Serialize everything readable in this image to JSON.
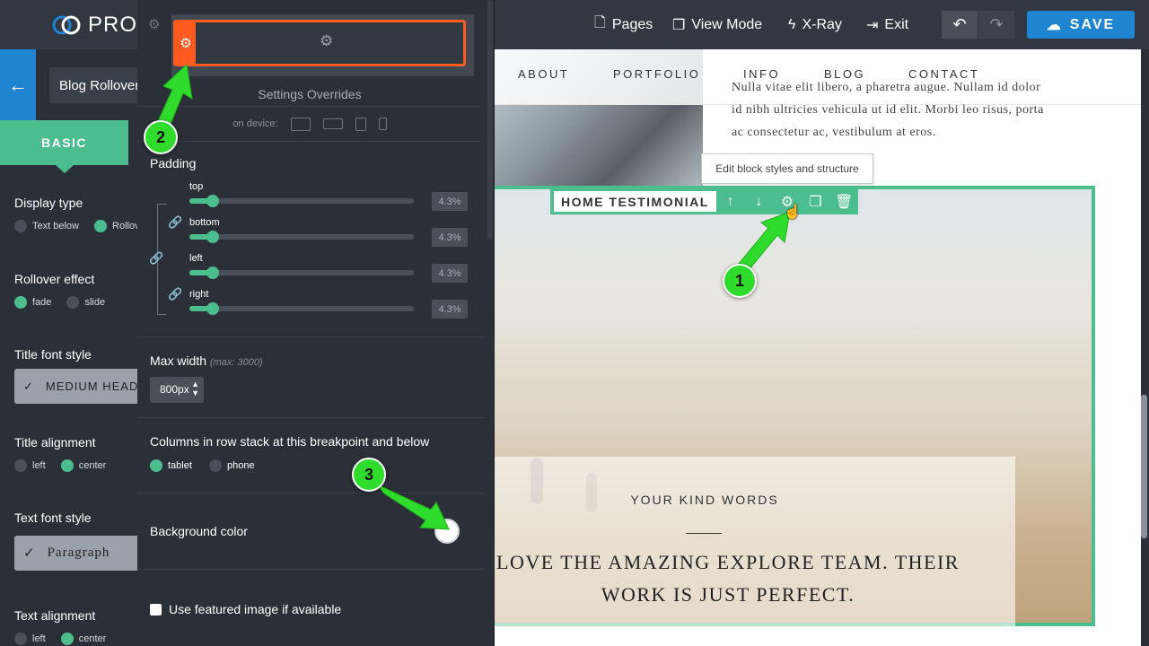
{
  "topbar": {
    "logo_text": "PRO",
    "nav": [
      {
        "label": "Pages"
      },
      {
        "label": "View Mode"
      },
      {
        "label": "X-Ray"
      },
      {
        "label": "Exit"
      }
    ],
    "save_label": "SAVE"
  },
  "left_panel": {
    "block_name": "Blog Rollover",
    "tab_label": "BASIC",
    "display_type": {
      "label": "Display type",
      "options": [
        "Text below",
        "Rollover"
      ],
      "selected": "Rollover"
    },
    "rollover_effect": {
      "label": "Rollover effect",
      "options": [
        "fade",
        "slide"
      ],
      "selected": "fade"
    },
    "title_font_style": {
      "label": "Title font style",
      "value": "MEDIUM HEADING"
    },
    "title_alignment": {
      "label": "Title alignment",
      "options": [
        "left",
        "center"
      ],
      "selected": "center"
    },
    "text_font_style": {
      "label": "Text font style",
      "value": "Paragraph"
    },
    "text_alignment": {
      "label": "Text alignment",
      "options": [
        "left",
        "center"
      ],
      "selected": "center"
    }
  },
  "settings": {
    "title": "Settings Overrides",
    "device_label": "on device:",
    "padding": {
      "label": "Padding",
      "rows": [
        {
          "name": "top",
          "value": "4.3%",
          "fraction": 0.043
        },
        {
          "name": "bottom",
          "value": "4.3%",
          "fraction": 0.043
        },
        {
          "name": "left",
          "value": "4.3%",
          "fraction": 0.043
        },
        {
          "name": "right",
          "value": "4.3%",
          "fraction": 0.043
        }
      ]
    },
    "max_width": {
      "label": "Max width",
      "hint": "(max: 3000)",
      "value": "800px"
    },
    "columns_stack": {
      "label": "Columns in row stack at this breakpoint and below",
      "options": [
        "tablet",
        "phone"
      ],
      "selected": "tablet"
    },
    "background_color": {
      "label": "Background color",
      "value": "#ffffff"
    },
    "featured_image": {
      "label": "Use featured image if available",
      "checked": false
    }
  },
  "canvas": {
    "nav": [
      "ABOUT",
      "PORTFOLIO",
      "INFO",
      "BLOG",
      "CONTACT"
    ],
    "lorem": "Nulla vitae elit libero, a pharetra augue. Nullam id dolor id nibh ultricies vehicula ut id elit. Morbi leo risus, porta ac consectetur ac, vestibulum at eros.",
    "tooltip": "Edit block styles and structure",
    "block_title": "HOME TESTIMONIAL",
    "testimonial_heading": "YOUR KIND WORDS",
    "testimonial_quote": "LOVE THE AMAZING EXPLORE TEAM. THEIR WORK IS JUST PERFECT."
  },
  "annotations": [
    "1",
    "2",
    "3"
  ],
  "colors": {
    "accent": "#4bbd8f",
    "primary": "#1f85d0",
    "override": "#ff5a1f",
    "arrow": "#2fdc2b"
  }
}
